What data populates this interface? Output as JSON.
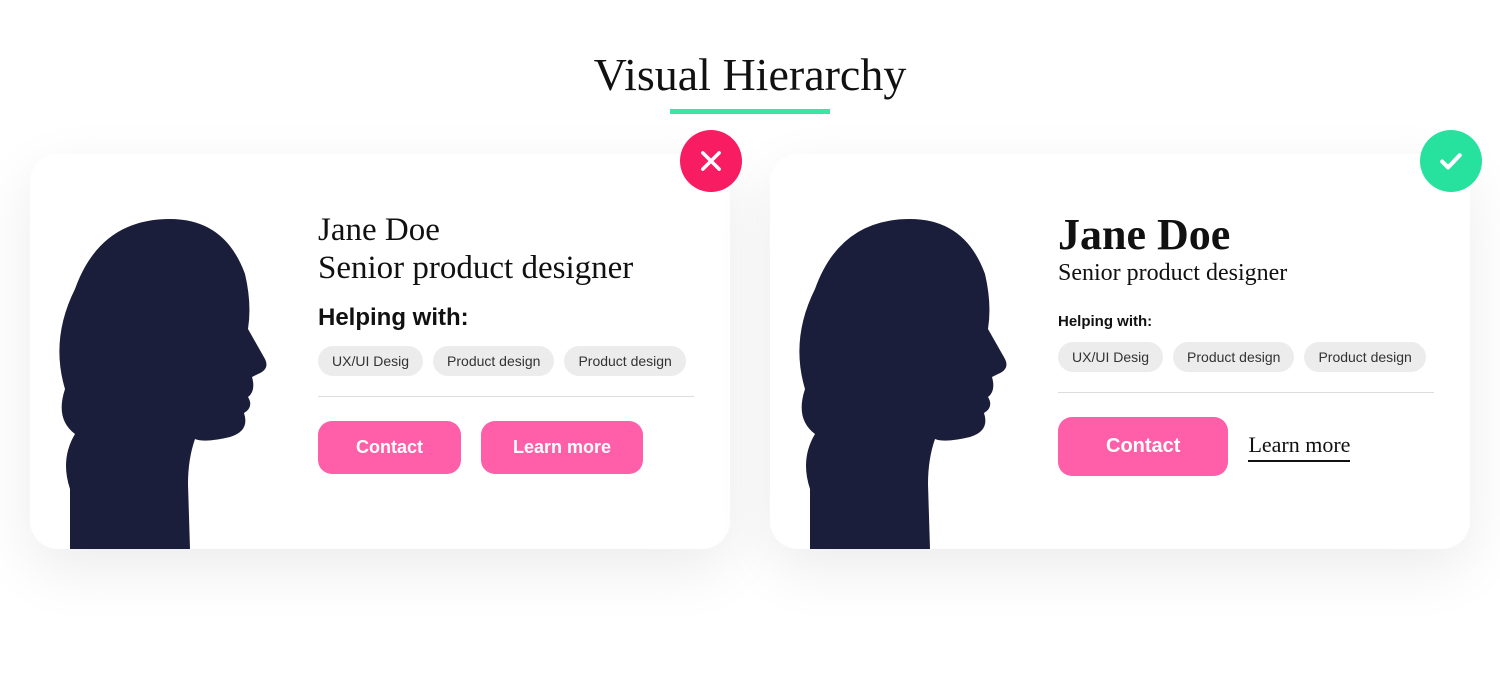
{
  "title": "Visual Hierarchy",
  "cards": {
    "bad": {
      "name": "Jane Doe",
      "role": "Senior product designer",
      "helping_label": "Helping with:",
      "tags": [
        "UX/UI Desig",
        "Product design",
        "Product design"
      ],
      "contact_label": "Contact",
      "learn_more_label": "Learn more",
      "badge": "cross"
    },
    "good": {
      "name": "Jane Doe",
      "role": "Senior product designer",
      "helping_label": "Helping with:",
      "tags": [
        "UX/UI Desig",
        "Product design",
        "Product design"
      ],
      "contact_label": "Contact",
      "learn_more_label": "Learn more",
      "badge": "check"
    }
  },
  "colors": {
    "accent_underline": "#3fe3a3",
    "badge_bad": "#f81d62",
    "badge_good": "#27e29e",
    "primary_button": "#ff5ea8",
    "silhouette": "#1a1e3a"
  }
}
